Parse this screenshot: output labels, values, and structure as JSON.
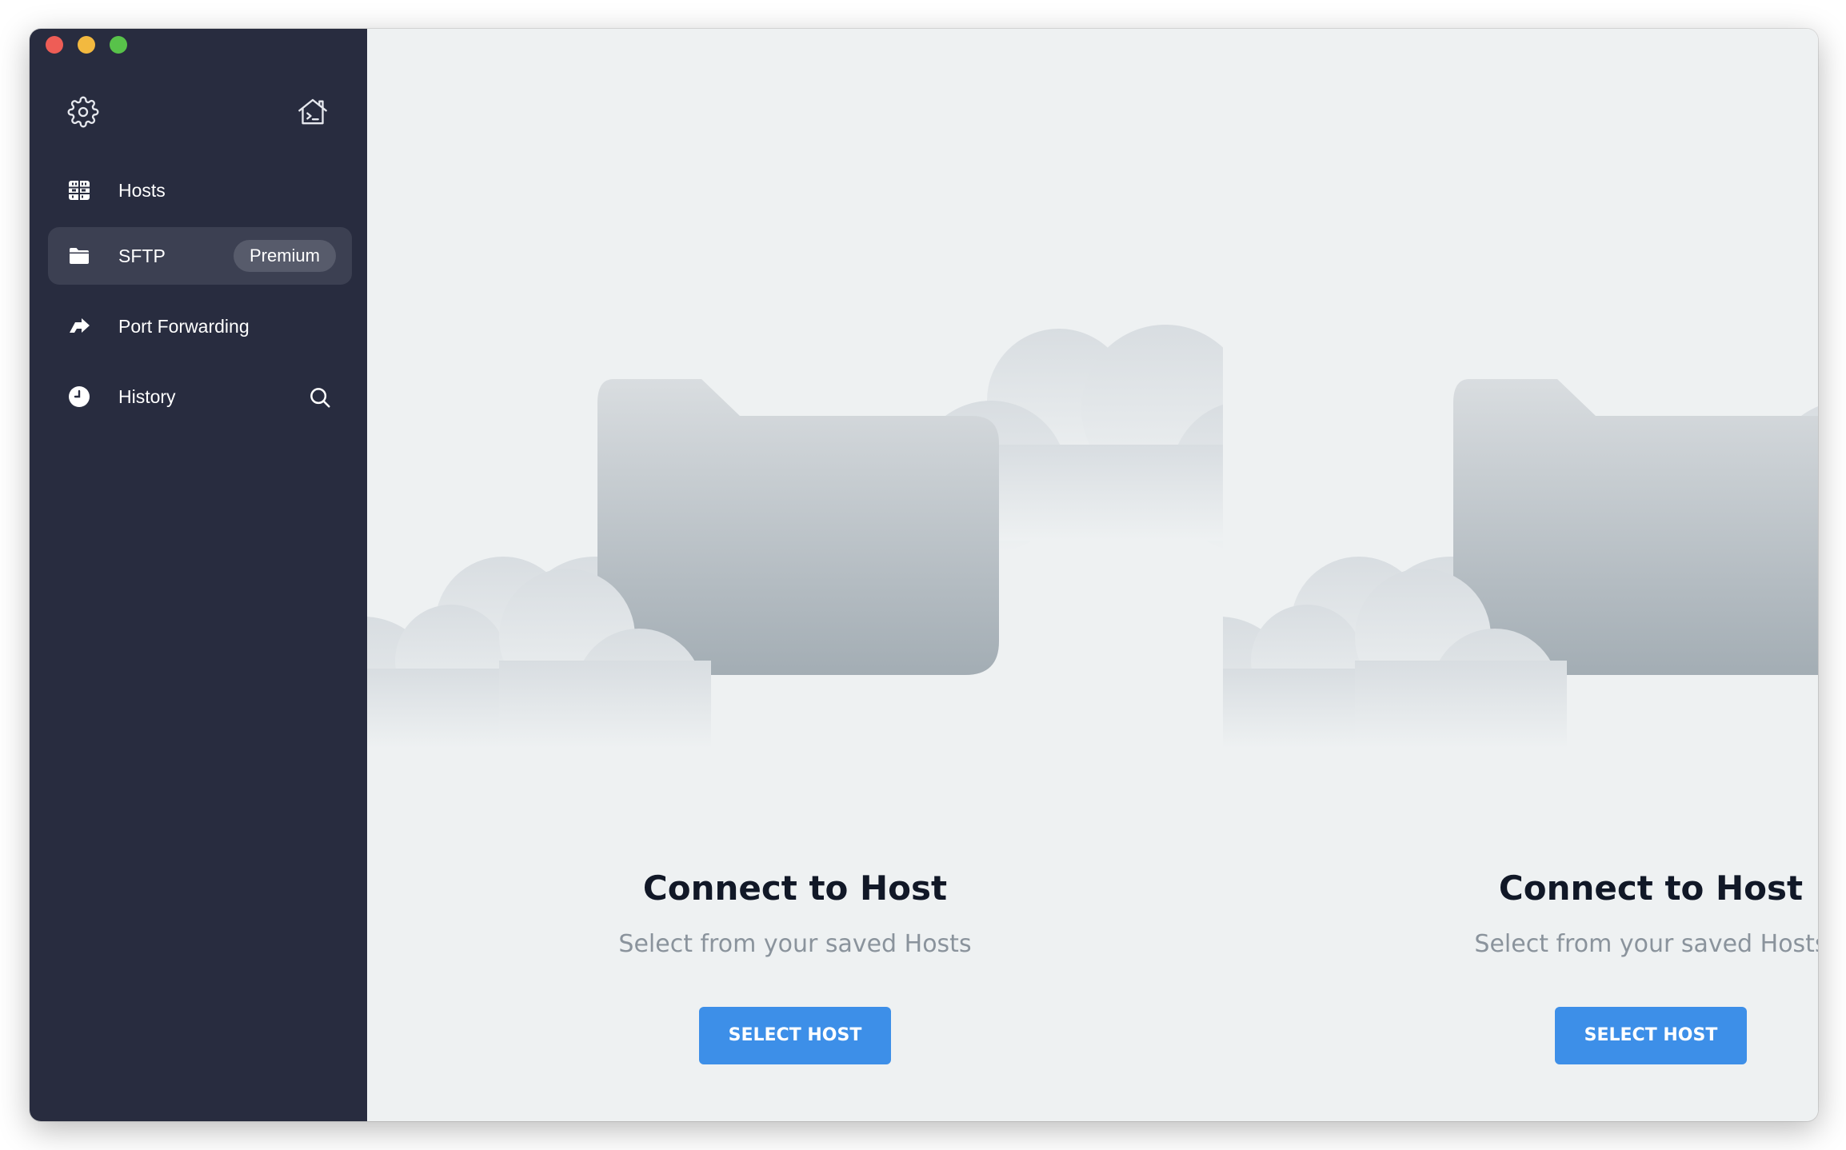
{
  "window": {
    "traffic_lights": [
      "close",
      "minimize",
      "maximize"
    ]
  },
  "sidebar": {
    "top_icons": {
      "settings": "gear-icon",
      "terminal_home": "terminal-home-icon"
    },
    "items": [
      {
        "label": "Hosts",
        "icon": "server-grid-icon",
        "active": false
      },
      {
        "label": "SFTP",
        "icon": "folder-icon",
        "active": true,
        "badge": "Premium"
      },
      {
        "label": "Port Forwarding",
        "icon": "port-forwarding-icon",
        "active": false
      },
      {
        "label": "History",
        "icon": "clock-icon",
        "active": false,
        "action_icon": "search-icon"
      }
    ]
  },
  "main": {
    "panels": [
      {
        "title": "Connect to Host",
        "subtitle": "Select from your saved Hosts",
        "button": "SELECT HOST",
        "illustration": "folder-with-clouds"
      },
      {
        "title": "Connect to Host",
        "subtitle": "Select from your saved Hosts",
        "button": "SELECT HOST",
        "illustration": "folder-with-clouds"
      }
    ]
  },
  "colors": {
    "sidebar_bg": "#282c3f",
    "sidebar_active": "#3c4052",
    "badge_bg": "#575b6b",
    "main_bg": "#eef1f2",
    "accent": "#3d8fe8",
    "title": "#111827",
    "subtitle": "#8a939c"
  }
}
